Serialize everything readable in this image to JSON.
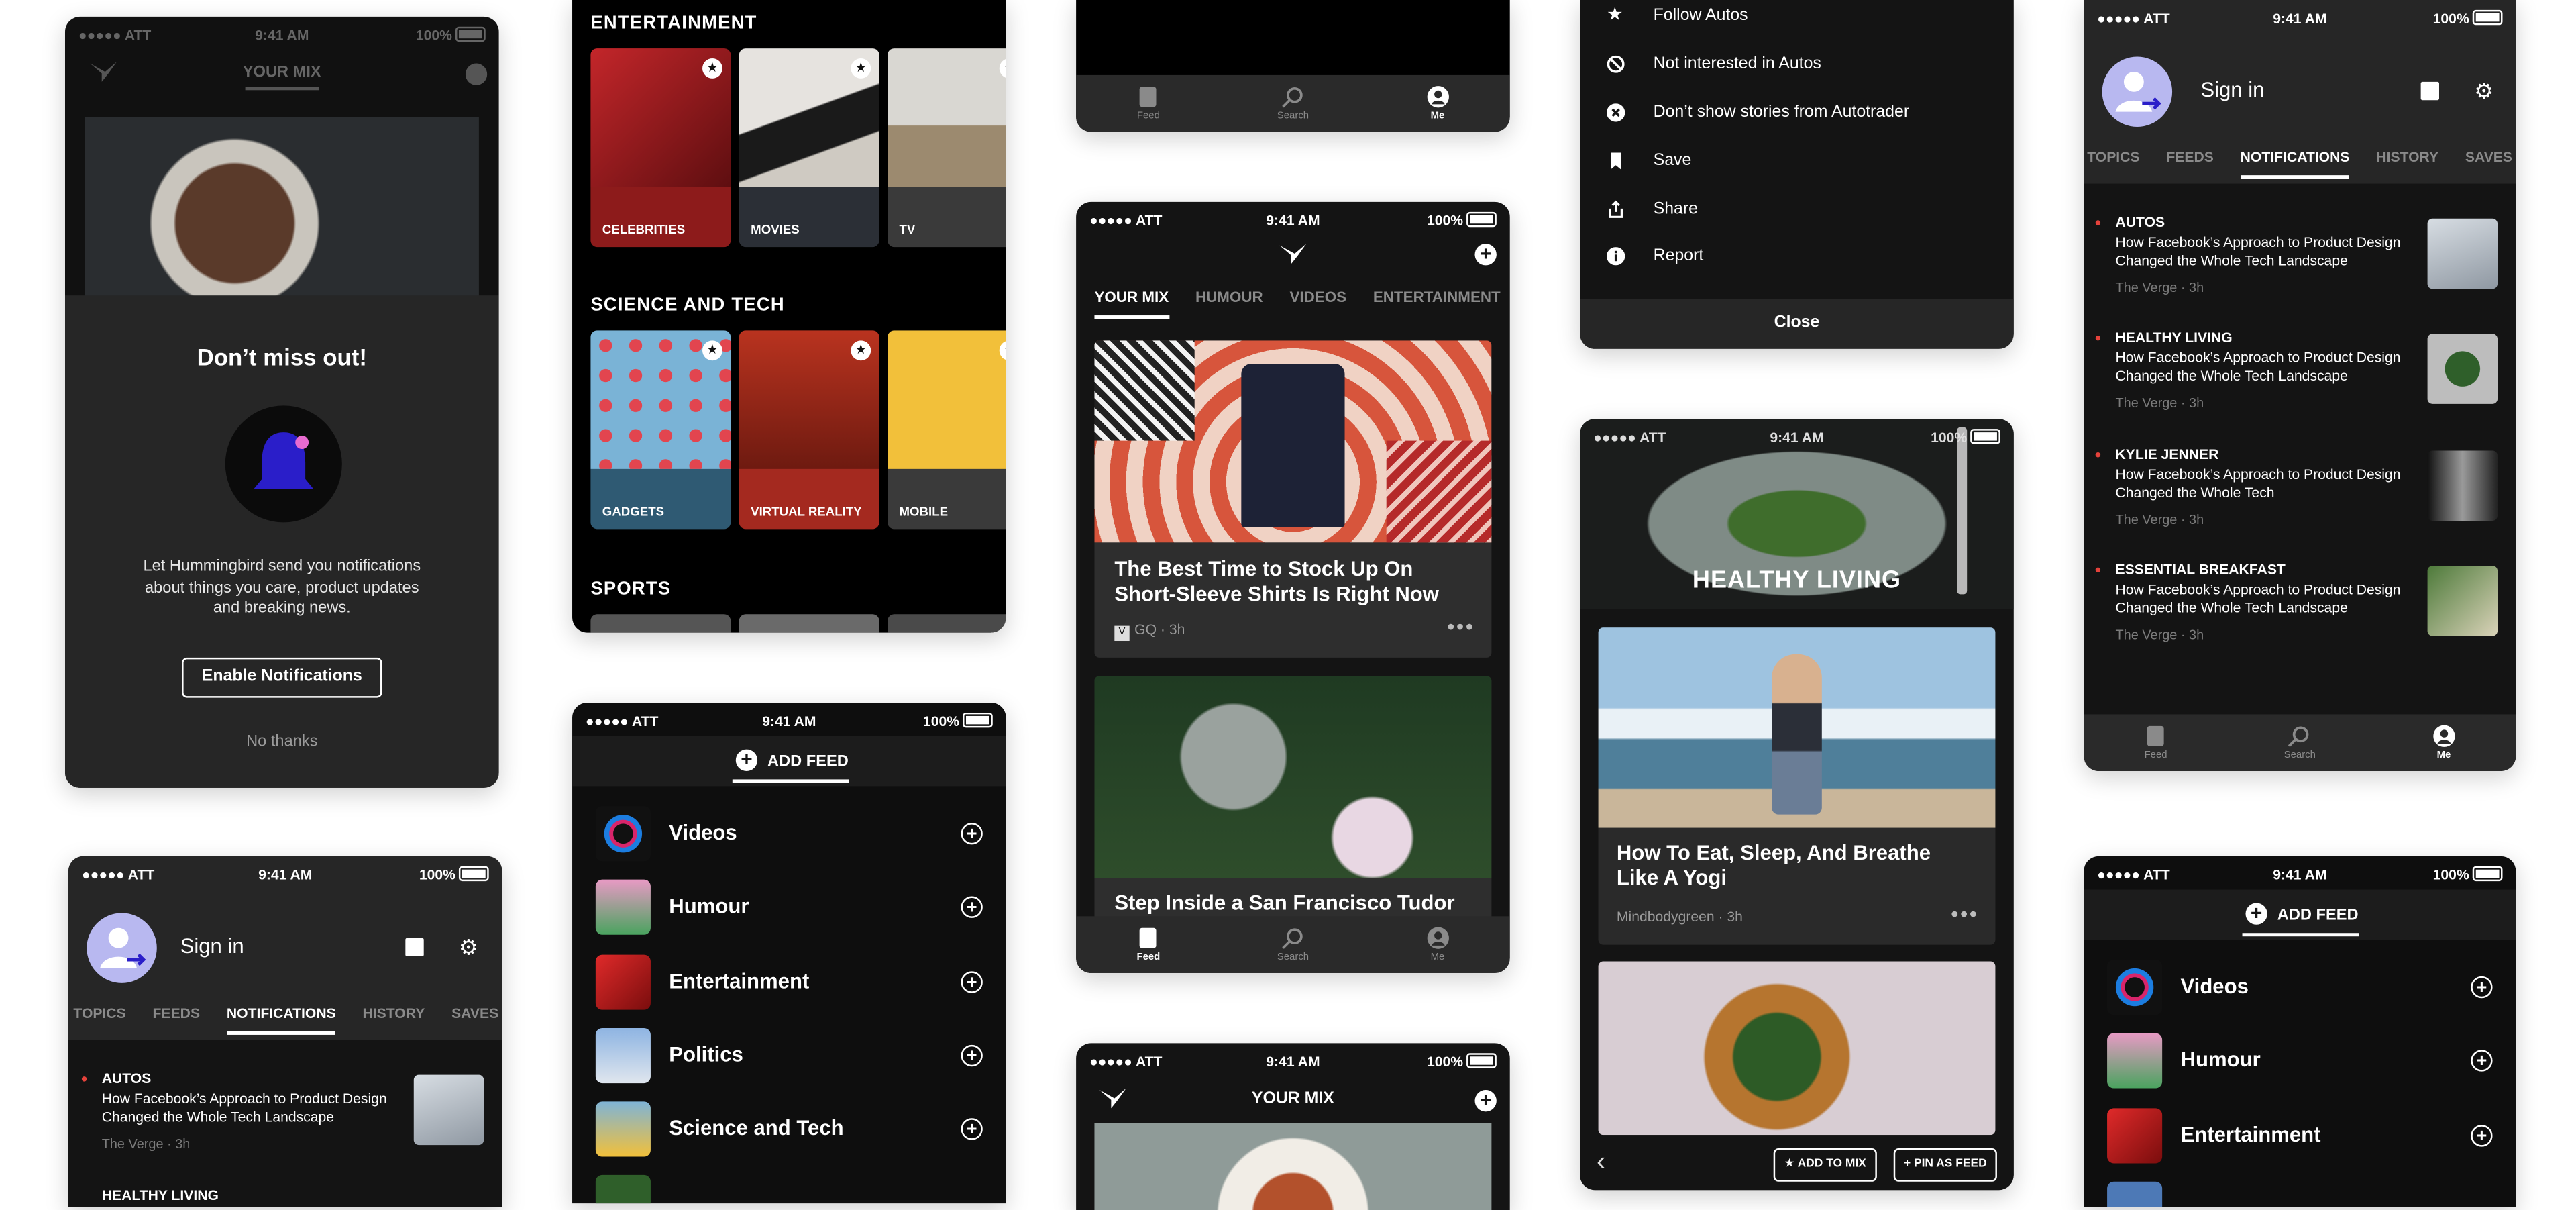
{
  "status": {
    "carrier": "ATT",
    "time": "9:41 AM",
    "battery": "100%"
  },
  "tabbar": {
    "feed": "Feed",
    "search": "Search",
    "me": "Me"
  },
  "p1": {
    "header": "YOUR MIX",
    "title": "Don’t miss out!",
    "body": "Let Hummingbird send you notifications about things you care, product updates and breaking news.",
    "enable": "Enable Notifications",
    "no_thanks": "No thanks"
  },
  "p2": {
    "sections": [
      {
        "title": "ENTERTAINMENT",
        "tiles": [
          "CELEBRITIES",
          "MOVIES",
          "TV"
        ]
      },
      {
        "title": "SCIENCE AND TECH",
        "tiles": [
          "GADGETS",
          "VIRTUAL REALITY",
          "MOBILE"
        ]
      },
      {
        "title": "SPORTS"
      }
    ]
  },
  "p3": {
    "tabs": [
      "YOUR MIX",
      "HUMOUR",
      "VIDEOS",
      "ENTERTAINMENT"
    ],
    "cards": [
      {
        "title": "The Best Time to Stock Up On Short-Sleeve Shirts Is Right Now",
        "source": "GQ · 3h"
      },
      {
        "title": "Step Inside a San Francisco Tudor"
      }
    ]
  },
  "p4": {
    "header": "YOUR MIX"
  },
  "menu": {
    "items": [
      "Follow Autos",
      "Not interested in Autos",
      "Don’t show stories from Autotrader",
      "Save",
      "Share",
      "Report"
    ],
    "close": "Close"
  },
  "p5": {
    "hero": "HEALTHY LIVING",
    "card": {
      "title": "How To Eat, Sleep, And Breathe Like A Yogi",
      "source": "Mindbodygreen · 3h"
    },
    "add_to_mix": "★ ADD TO MIX",
    "pin": "+ PIN AS FEED"
  },
  "profile": {
    "sign_in": "Sign in",
    "tabs": [
      "TOPICS",
      "FEEDS",
      "NOTIFICATIONS",
      "HISTORY",
      "SAVES"
    ],
    "notifications": [
      {
        "cat": "AUTOS",
        "title": "How Facebook’s Approach to Product Design Changed the Whole Tech Landscape",
        "src": "The Verge · 3h"
      },
      {
        "cat": "HEALTHY LIVING",
        "title": "How Facebook’s Approach to Product Design Changed the Whole Tech Landscape",
        "src": "The Verge · 3h"
      },
      {
        "cat": "KYLIE JENNER",
        "title": "How Facebook’s Approach to Product Design Changed the Whole Tech",
        "src": "The Verge · 3h"
      },
      {
        "cat": "ESSENTIAL BREAKFAST",
        "title": "How Facebook’s Approach to Product Design Changed the Whole Tech Landscape",
        "src": "The Verge · 3h"
      }
    ],
    "bottom_cat": "HEALTHY LIVING"
  },
  "addfeed": {
    "title": "ADD FEED",
    "feeds": [
      "Videos",
      "Humour",
      "Entertainment",
      "Politics",
      "Science and Tech"
    ]
  }
}
